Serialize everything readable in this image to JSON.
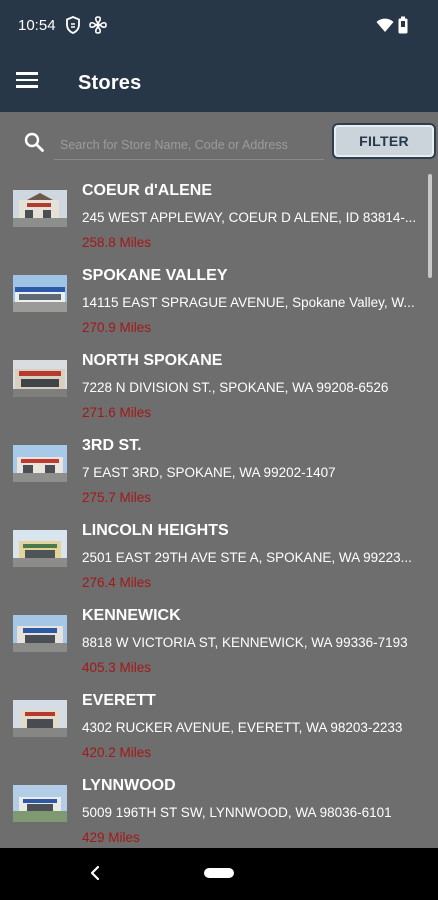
{
  "status_bar": {
    "time": "10:54",
    "icons": [
      "shield-icon",
      "fan-icon",
      "wifi-icon",
      "battery-icon"
    ]
  },
  "app_bar": {
    "title": "Stores",
    "menu_icon": "hamburger-menu-icon"
  },
  "search": {
    "placeholder": "Search for Store Name, Code or Address",
    "value": "",
    "filter_label": "FILTER"
  },
  "stores": [
    {
      "name": "COEUR d'ALENE",
      "address": "245 WEST APPLEWAY, COEUR D ALENE, ID  83814-...",
      "distance": "258.8 Miles"
    },
    {
      "name": "SPOKANE VALLEY",
      "address": "14115 EAST SPRAGUE AVENUE, Spokane Valley, W...",
      "distance": "270.9 Miles"
    },
    {
      "name": "NORTH SPOKANE",
      "address": "7228 N DIVISION ST., SPOKANE, WA  99208-6526",
      "distance": "271.6 Miles"
    },
    {
      "name": "3RD ST.",
      "address": "7 EAST 3RD, SPOKANE, WA  99202-1407",
      "distance": "275.7 Miles"
    },
    {
      "name": "LINCOLN HEIGHTS",
      "address": "2501 EAST 29TH AVE STE A, SPOKANE, WA  99223...",
      "distance": "276.4 Miles"
    },
    {
      "name": "KENNEWICK",
      "address": "8818 W VICTORIA ST, KENNEWICK, WA  99336-7193",
      "distance": "405.3 Miles"
    },
    {
      "name": "EVERETT",
      "address": "4302 RUCKER AVENUE, EVERETT, WA  98203-2233",
      "distance": "420.2 Miles"
    },
    {
      "name": "LYNNWOOD",
      "address": "5009 196TH ST SW, LYNNWOOD, WA  98036-6101",
      "distance": "429 Miles"
    }
  ],
  "colors": {
    "app_bar": "#283747",
    "background": "#6e6e6e",
    "distance_text": "#a31818",
    "filter_button_bg": "#cbd3db"
  },
  "nav_bar": {
    "icons": [
      "back-icon",
      "home-pill-icon"
    ]
  }
}
